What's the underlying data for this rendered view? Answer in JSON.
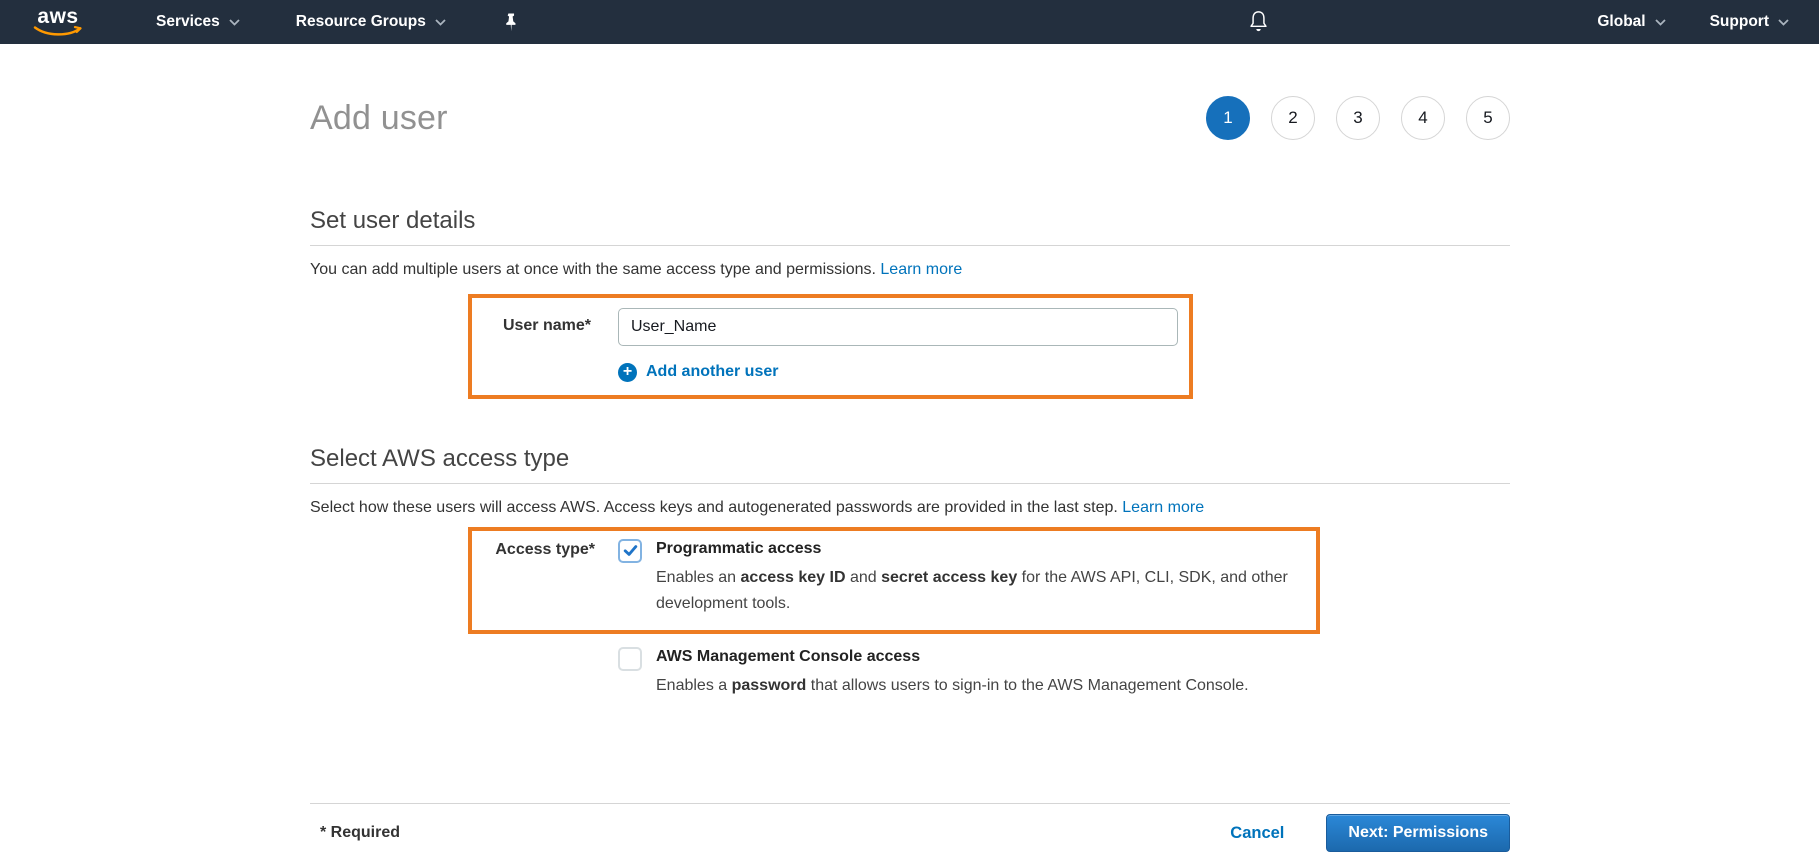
{
  "colors": {
    "nav_bg": "#232f3e",
    "accent_orange": "#ed7c22",
    "link_blue": "#0073bb",
    "step_active_blue": "#1670bb",
    "logo_smile_orange": "#ff9900",
    "next_button_blue": "#1f74c2"
  },
  "nav": {
    "logo_text": "aws",
    "services_label": "Services",
    "resource_groups_label": "Resource Groups",
    "global_label": "Global",
    "support_label": "Support"
  },
  "header": {
    "title": "Add user",
    "steps": [
      "1",
      "2",
      "3",
      "4",
      "5"
    ],
    "current_step": "1"
  },
  "user_details": {
    "heading": "Set user details",
    "description": "You can add multiple users at once with the same access type and permissions. ",
    "learn_more_label": "Learn more",
    "user_name_label": "User name*",
    "user_name_value": "User_Name",
    "add_another_user_label": "Add another user",
    "plus_glyph": "+"
  },
  "access_type": {
    "heading": "Select AWS access type",
    "description": "Select how these users will access AWS. Access keys and autogenerated passwords are provided in the last step. ",
    "learn_more_label": "Learn more",
    "access_type_label": "Access type*",
    "programmatic": {
      "label": "Programmatic access",
      "checked": true,
      "desc_part1": "Enables an ",
      "desc_bold1": "access key ID",
      "desc_part2": " and ",
      "desc_bold2": "secret access key",
      "desc_part3": " for the AWS API, CLI, SDK, and other development tools."
    },
    "console": {
      "label": "AWS Management Console access",
      "checked": false,
      "desc_part1": "Enables a ",
      "desc_bold1": "password",
      "desc_part2": " that allows users to sign-in to the AWS Management Console."
    }
  },
  "footer": {
    "required_note": "* Required",
    "cancel_label": "Cancel",
    "next_label": "Next: Permissions"
  }
}
